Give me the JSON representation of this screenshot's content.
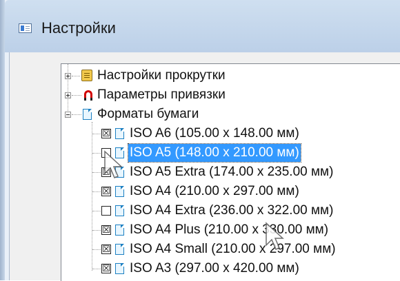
{
  "window": {
    "title": "Настройки",
    "icon": "settings-window-icon"
  },
  "tree": {
    "nodes": [
      {
        "label": "Настройки прокрутки",
        "icon": "scroll-icon",
        "expander": "plus",
        "level": 0
      },
      {
        "label": "Параметры привязки",
        "icon": "magnet-icon",
        "expander": "plus",
        "level": 0
      },
      {
        "label": "Форматы бумаги",
        "icon": "document-icon",
        "expander": "minus",
        "level": 0
      }
    ],
    "paper_formats": [
      {
        "label": "ISO A6 (105.00 x 148.00 мм)",
        "checked": true,
        "selected": false
      },
      {
        "label": "ISO A5 (148.00 x 210.00 мм)",
        "checked": false,
        "selected": true
      },
      {
        "label": "ISO A5 Extra (174.00 x 235.00 мм)",
        "checked": true,
        "selected": false
      },
      {
        "label": "ISO A4 (210.00 x 297.00 мм)",
        "checked": true,
        "selected": false
      },
      {
        "label": "ISO A4 Extra (236.00 x 322.00 мм)",
        "checked": false,
        "selected": false
      },
      {
        "label": "ISO A4 Plus (210.00 x 330.00 мм)",
        "checked": true,
        "selected": false
      },
      {
        "label": "ISO A4 Small (210.00 x 297.00 мм)",
        "checked": true,
        "selected": false
      },
      {
        "label": "ISO A3 (297.00 x 420.00 мм)",
        "checked": true,
        "selected": false
      }
    ],
    "check_mark": "☒"
  },
  "colors": {
    "selection": "#3399ff",
    "titlebar": "#c4d7ec"
  }
}
